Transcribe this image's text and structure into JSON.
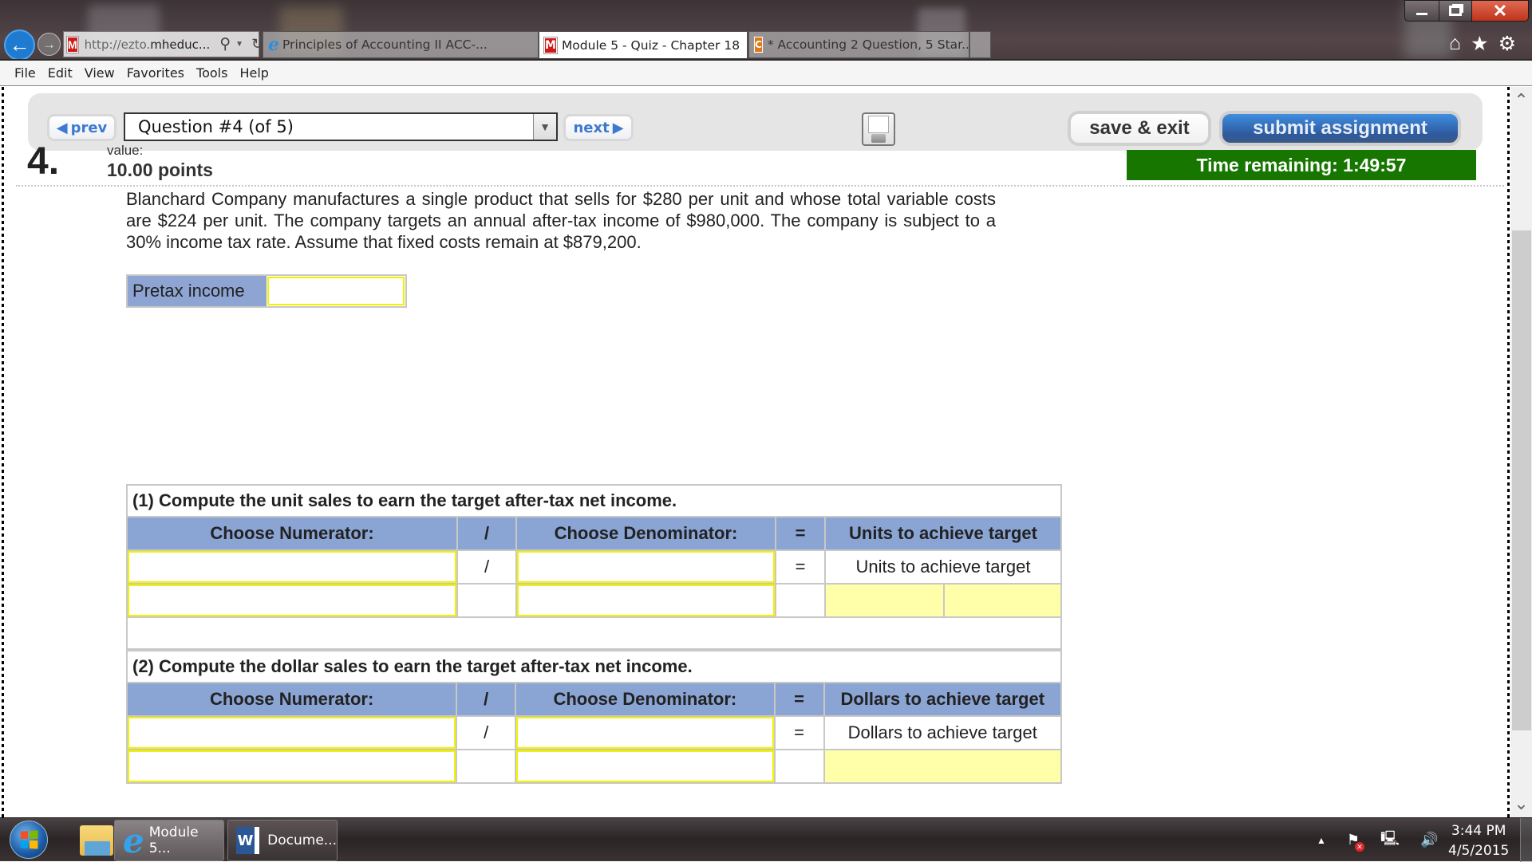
{
  "browser": {
    "address": {
      "prefix": "http://ezto.",
      "domain": "mheduc...",
      "favicon": "mcgraw-hill-m-icon"
    },
    "tabs": [
      {
        "label": "Principles of Accounting II ACC-...",
        "icon": "ie-icon",
        "active": false
      },
      {
        "label": "Module 5 - Quiz - Chapter 18",
        "icon": "mcgraw-hill-m-icon",
        "active": true,
        "close": "×"
      },
      {
        "label": "* Accounting 2 Question, 5 Star...",
        "icon": "chegg-c-icon",
        "active": false
      }
    ],
    "tab_favicon_m": "M",
    "tab_favicon_c": "C",
    "toolbar_icons": [
      "home-icon",
      "favorites-star-icon",
      "settings-gear-icon"
    ],
    "window_controls": {
      "close": "✕"
    }
  },
  "menu": [
    "File",
    "Edit",
    "View",
    "Favorites",
    "Tools",
    "Help"
  ],
  "quiz_nav": {
    "prev_label": "prev",
    "next_label": "next",
    "question_selector": "Question #4 (of 5)",
    "save_exit_label": "save & exit",
    "submit_label": "submit assignment"
  },
  "question": {
    "number": "4.",
    "value_label": "value:",
    "points": "10.00 points",
    "timer": "Time remaining: 1:49:57",
    "text": "Blanchard Company manufactures a single product that sells for $280 per unit and whose total variable costs are $224 per unit. The company targets an annual after-tax income of $980,000. The company is subject to a 30% income tax rate. Assume that fixed costs remain at $879,200.",
    "pretax_label": "Pretax income",
    "pretax_value": ""
  },
  "part1": {
    "title": "(1) Compute the unit sales to earn the target after-tax net income.",
    "headers": [
      "Choose Numerator:",
      "/",
      "Choose Denominator:",
      "=",
      "Units to achieve target"
    ],
    "row1": {
      "op": "/",
      "eq": "=",
      "result_label": "Units to achieve target"
    }
  },
  "part2": {
    "title": "(2) Compute the dollar sales to earn the target after-tax net income.",
    "headers": [
      "Choose Numerator:",
      "/",
      "Choose Denominator:",
      "=",
      "Dollars to achieve target"
    ],
    "row1": {
      "op": "/",
      "eq": "=",
      "result_label": "Dollars to achieve target"
    }
  },
  "taskbar": {
    "items": [
      {
        "label": "Module 5...",
        "icon": "internet-explorer-icon"
      },
      {
        "label": "Docume...",
        "icon": "word-icon"
      }
    ],
    "word_letter": "W",
    "clock_time": "3:44 PM",
    "clock_date": "4/5/2015"
  }
}
